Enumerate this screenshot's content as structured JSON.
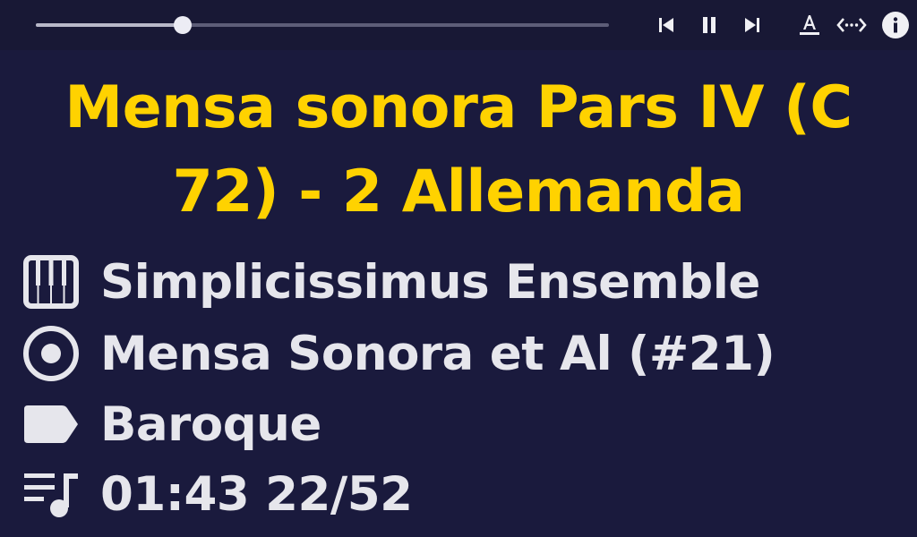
{
  "player": {
    "progress_fraction": 0.257,
    "controls": {
      "previous_icon": "skip-previous-icon",
      "pause_icon": "pause-icon",
      "next_icon": "skip-next-icon",
      "font_icon": "text-format-icon",
      "expand_icon": "expand-horizontal-icon",
      "info_icon": "info-icon"
    }
  },
  "track": {
    "title": "Mensa sonora Pars IV (C 72) - 2 Allemanda",
    "artist": "Simplicissimus Ensemble",
    "album": "Mensa Sonora et Al (#21)",
    "genre": "Baroque",
    "position": "01:43 22/52"
  },
  "icons": {
    "artist": "piano-icon",
    "album": "disc-icon",
    "genre": "label-tag-icon",
    "position": "playlist-music-icon"
  },
  "colors": {
    "background": "#1a1a3d",
    "title": "#ffd200",
    "text": "#e6e6ec"
  }
}
